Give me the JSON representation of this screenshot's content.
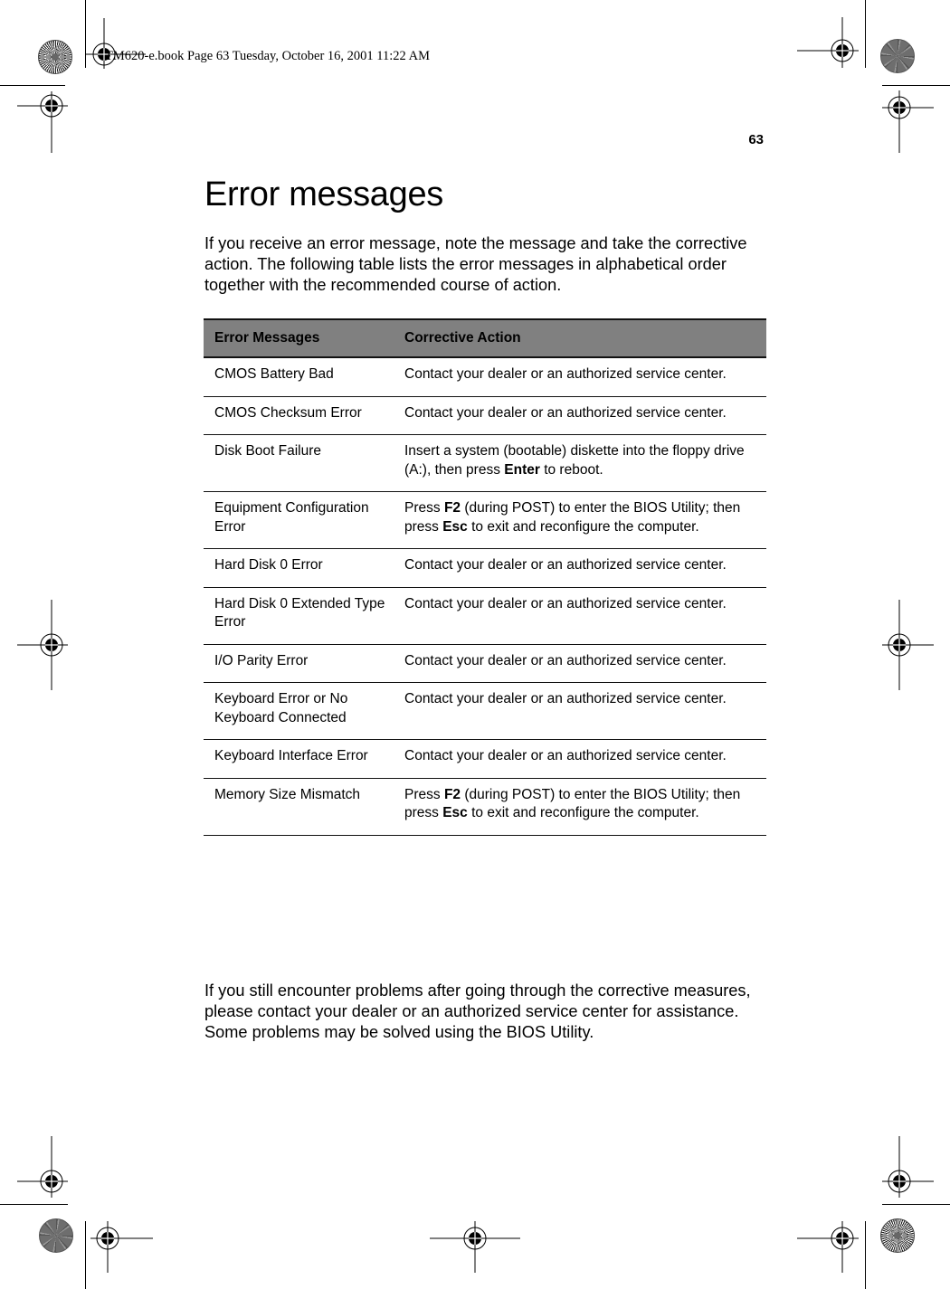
{
  "slug": "TM620-e.book  Page 63  Tuesday, October 16, 2001  11:22 AM",
  "page_number": "63",
  "title": "Error messages",
  "intro": "If you receive an error message, note the message and take the corrective action.  The following table lists the error messages in alphabetical order together with the recommended course of action.",
  "table": {
    "headers": [
      "Error Messages",
      "Corrective Action"
    ],
    "rows": [
      {
        "message": "CMOS Battery Bad",
        "action": [
          {
            "t": "Contact your dealer or an authorized service center."
          }
        ]
      },
      {
        "message": "CMOS Checksum Error",
        "action": [
          {
            "t": "Contact your dealer or an authorized service center."
          }
        ]
      },
      {
        "message": "Disk Boot Failure",
        "action": [
          {
            "t": "Insert a system (bootable) diskette into the floppy drive (A:), then press "
          },
          {
            "t": "Enter",
            "b": true
          },
          {
            "t": " to reboot."
          }
        ]
      },
      {
        "message": "Equipment Configuration Error",
        "action": [
          {
            "t": "Press "
          },
          {
            "t": "F2",
            "b": true
          },
          {
            "t": " (during POST) to enter the BIOS Utility; then press "
          },
          {
            "t": "Esc",
            "b": true
          },
          {
            "t": " to exit and reconfigure the computer."
          }
        ]
      },
      {
        "message": "Hard Disk 0 Error",
        "action": [
          {
            "t": "Contact your dealer or an authorized service center."
          }
        ]
      },
      {
        "message": "Hard Disk 0 Extended Type Error",
        "action": [
          {
            "t": "Contact your dealer or an authorized service center."
          }
        ]
      },
      {
        "message": "I/O Parity Error",
        "action": [
          {
            "t": "Contact your dealer or an authorized service center."
          }
        ]
      },
      {
        "message": "Keyboard Error or No Keyboard Connected",
        "action": [
          {
            "t": "Contact your dealer or an authorized service center."
          }
        ]
      },
      {
        "message": "Keyboard Interface Error",
        "action": [
          {
            "t": "Contact your dealer or an authorized service center."
          }
        ]
      },
      {
        "message": "Memory Size Mismatch",
        "action": [
          {
            "t": "Press "
          },
          {
            "t": "F2",
            "b": true
          },
          {
            "t": " (during POST) to enter the BIOS Utility; then press "
          },
          {
            "t": "Esc",
            "b": true
          },
          {
            "t": " to exit and reconfigure the computer."
          }
        ]
      }
    ]
  },
  "outro": "If you still encounter problems after going through the corrective measures, please contact your dealer or an authorized service center for assistance.  Some problems may be solved using the BIOS Utility.",
  "colors": {
    "header_fill": "#808080",
    "rule": "#111111"
  }
}
